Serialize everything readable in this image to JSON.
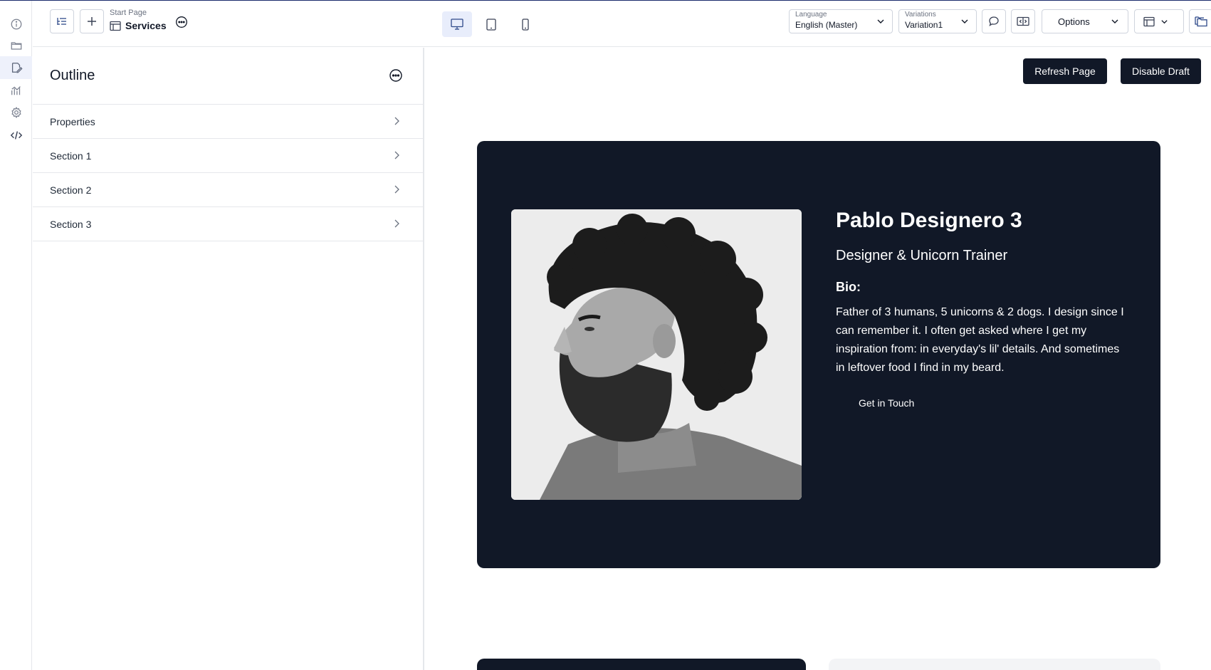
{
  "rail": {
    "items": [
      {
        "icon": "info-icon"
      },
      {
        "icon": "folder-icon"
      },
      {
        "icon": "page-edit-icon"
      },
      {
        "icon": "analytics-icon"
      },
      {
        "icon": "gear-icon"
      },
      {
        "icon": "code-icon"
      }
    ]
  },
  "topbar": {
    "breadcrumb_parent": "Start Page",
    "breadcrumb_current": "Services",
    "language_label": "Language",
    "language_value": "English (Master)",
    "variations_label": "Variations",
    "variations_value": "Variation1",
    "options_label": "Options"
  },
  "outline": {
    "title": "Outline",
    "rows": [
      {
        "label": "Properties"
      },
      {
        "label": "Section 1"
      },
      {
        "label": "Section 2"
      },
      {
        "label": "Section 3"
      }
    ]
  },
  "preview": {
    "refresh_label": "Refresh Page",
    "disable_draft_label": "Disable Draft",
    "hero": {
      "name": "Pablo Designero 3",
      "role": "Designer & Unicorn Trainer",
      "bio_heading": "Bio:",
      "bio_text": "Father of 3 humans, 5 unicorns & 2 dogs. I design since I can remember it. I often get asked where I get my inspiration from: in everyday's lil' details. And sometimes in leftover food I find in my beard.",
      "cta_label": "Get in Touch"
    }
  },
  "colors": {
    "dark_navy": "#111827",
    "active_blue": "#e8edfb",
    "border": "#e5e7eb"
  }
}
